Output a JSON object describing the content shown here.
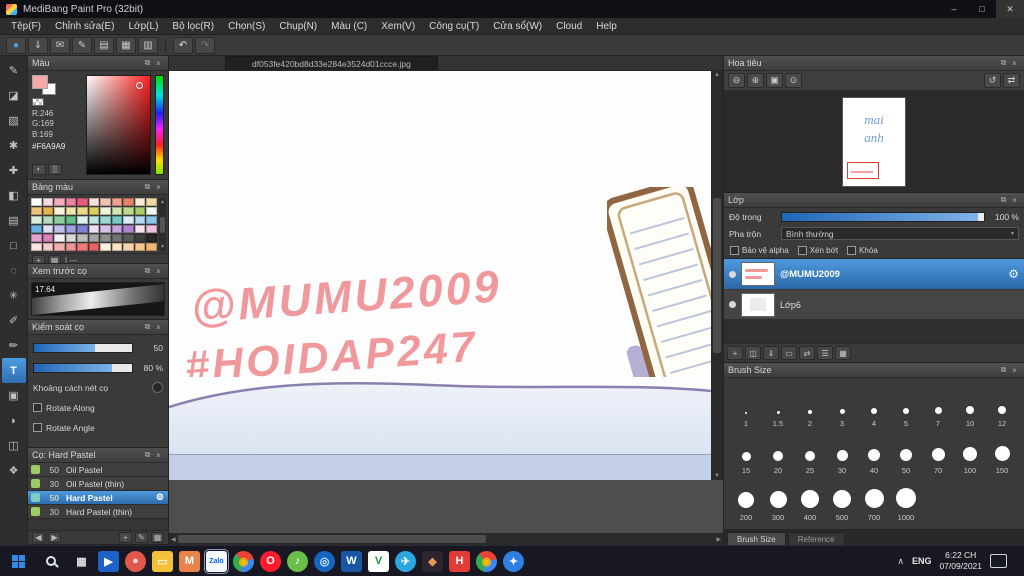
{
  "window": {
    "title": "MediBang Paint Pro (32bit)",
    "min": "–",
    "max": "□",
    "close": "✕"
  },
  "ui": {
    "pop": "⧉",
    "close": "×",
    "arrow_down": "▾",
    "left": "◀",
    "right": "▶",
    "up": "▲",
    "down": "▼",
    "gear": "⚙",
    "chevron_up": "∧"
  },
  "menu": {
    "items": [
      "Tệp(F)",
      "Chỉnh sửa(E)",
      "Lớp(L)",
      "Bộ lọc(R)",
      "Chọn(S)",
      "Chụp(N)",
      "Màu (C)",
      "Xem(V)",
      "Công cụ(T)",
      "Cửa sổ(W)",
      "Cloud",
      "Help"
    ]
  },
  "toolbar": {
    "buttons": [
      {
        "name": "brush-indicator-icon",
        "glyph": "●",
        "fg": "#4aa3e8"
      },
      {
        "name": "save-icon",
        "glyph": "⇓"
      },
      {
        "name": "comment-icon",
        "glyph": "✉"
      },
      {
        "name": "pen-icon",
        "glyph": "✎"
      },
      {
        "name": "page-icon",
        "glyph": "▤"
      },
      {
        "name": "grid-icon",
        "glyph": "▦"
      },
      {
        "name": "material-icon",
        "glyph": "▥"
      }
    ],
    "undo": "↶",
    "redo": "↷"
  },
  "tools": {
    "items": [
      {
        "name": "brush-tool",
        "glyph": "✎"
      },
      {
        "name": "eraser-tool",
        "glyph": "◪"
      },
      {
        "name": "rect-brush-tool",
        "glyph": "▧"
      },
      {
        "name": "smudge-tool",
        "glyph": "✱"
      },
      {
        "name": "move-tool",
        "glyph": "✚"
      },
      {
        "name": "fill-tool",
        "glyph": "◧"
      },
      {
        "name": "gradient-tool",
        "glyph": "▤"
      },
      {
        "name": "select-tool",
        "glyph": "□"
      },
      {
        "name": "lasso-tool",
        "glyph": "◌"
      },
      {
        "name": "magic-wand-tool",
        "glyph": "✳"
      },
      {
        "name": "select-pen-tool",
        "glyph": "✐"
      },
      {
        "name": "select-eraser-tool",
        "glyph": "✏"
      },
      {
        "name": "text-tool",
        "glyph": "T",
        "state": "active"
      },
      {
        "name": "operation-tool",
        "glyph": "▣"
      },
      {
        "name": "eyedropper-tool",
        "glyph": "◗"
      },
      {
        "name": "divide-tool",
        "glyph": "◫"
      },
      {
        "name": "hand-tool",
        "glyph": "❖"
      }
    ]
  },
  "color_panel": {
    "title": "Màu",
    "r": "R:246",
    "g": "G:169",
    "b": "B:169",
    "hex": "#F6A9A9",
    "current": "#F6A9A9",
    "mini": [
      {
        "name": "color-wheel-icon",
        "glyph": "◐"
      },
      {
        "name": "color-bar-icon",
        "glyph": "▒"
      }
    ]
  },
  "palette_panel": {
    "title": "Bảng màu",
    "label": "| ---",
    "foot_icons": [
      {
        "name": "add-swatch-icon",
        "glyph": "+"
      },
      {
        "name": "swatch-grid-icon",
        "glyph": "▦"
      }
    ],
    "swatches": [
      "#ffffff",
      "#f8d7dd",
      "#f2aebd",
      "#ec859c",
      "#e65c7b",
      "#f9e0d9",
      "#f3c1b2",
      "#eca28c",
      "#e58366",
      "#f9ecd2",
      "#f3d9a6",
      "#edc57a",
      "#e7b14e",
      "#f7f3d7",
      "#efe7af",
      "#e7db87",
      "#dfcf5f",
      "#e9f3d9",
      "#d3e7b3",
      "#bddb8d",
      "#a7cf67",
      "#f0f8f1",
      "#d9efdc",
      "#b3dfbf",
      "#8dcfa2",
      "#67bf85",
      "#ddf2f0",
      "#bbe5e1",
      "#99d8d2",
      "#77cbc3",
      "#d9ecf8",
      "#b3d9f1",
      "#8dc6ea",
      "#67b3e3",
      "#dfe0f5",
      "#bfc1eb",
      "#9fa2e1",
      "#7f83d7",
      "#ece0f4",
      "#d9c1e9",
      "#c6a2de",
      "#b383d3",
      "#f6e0ee",
      "#edc1dd",
      "#e4a2cc",
      "#db83bb",
      "#f2f2f2",
      "#d9d9d9",
      "#bfbfbf",
      "#a6a6a6",
      "#8c8c8c",
      "#737373",
      "#595959",
      "#404040",
      "#262626",
      "#fce4e4",
      "#f8caca",
      "#f4b0b0",
      "#f09696",
      "#ec7c7c",
      "#e86262",
      "#fdf1e3",
      "#fae3c7",
      "#f7d5ab",
      "#f4c78f",
      "#f1b973"
    ]
  },
  "preview_panel": {
    "title": "Xem trước cọ",
    "value": "17.64"
  },
  "control_panel": {
    "title": "Kiểm soát cọ",
    "slider1": "50",
    "slider2": "80 %",
    "opt1": "Khoảng cách nét cọ",
    "opt2": "Rotate Along",
    "opt3": "Rotate Angle"
  },
  "brush_panel": {
    "title": "Cọ: Hard Pastel",
    "items": [
      {
        "size": "50",
        "name": "Oil Pastel",
        "chip": "#9ccc65",
        "state": "",
        "gear": ""
      },
      {
        "size": "30",
        "name": "Oil Pastel (thin)",
        "chip": "#9ccc65",
        "state": "",
        "gear": ""
      },
      {
        "size": "50",
        "name": "Hard Pastel",
        "chip": "#80cbc4",
        "state": "selected",
        "gear": "⚙"
      },
      {
        "size": "30",
        "name": "Hard Pastel (thin)",
        "chip": "#9ccc65",
        "state": "",
        "gear": ""
      }
    ],
    "foot_left": [
      {
        "name": "prev-brush-icon",
        "glyph": "◀"
      },
      {
        "name": "next-brush-icon",
        "glyph": "▶"
      }
    ],
    "foot_right": [
      {
        "name": "add-brush-icon",
        "glyph": "+"
      },
      {
        "name": "edit-brush-icon",
        "glyph": "✎"
      },
      {
        "name": "brush-menu-icon",
        "glyph": "▦"
      }
    ]
  },
  "canvas": {
    "tab": "df053fe420bd8d33e284e3524d01ccce.jpg",
    "line1": "@MUMU2009",
    "line2": "#HOIDAP247",
    "ink": "#F0989C"
  },
  "navigator": {
    "title": "Hoa tiêu",
    "zoom_left": [
      {
        "name": "zoom-out-icon",
        "glyph": "⊖"
      },
      {
        "name": "zoom-in-icon",
        "glyph": "⊕"
      },
      {
        "name": "fit-screen-icon",
        "glyph": "▣"
      },
      {
        "name": "actual-size-icon",
        "glyph": "⊙"
      }
    ],
    "zoom_right": [
      {
        "name": "rotate-reset-icon",
        "glyph": "↺"
      },
      {
        "name": "flip-horizontal-icon",
        "glyph": "⇄"
      }
    ],
    "thumb": {
      "word1": "mai",
      "word2": "anh"
    }
  },
  "layers": {
    "title": "Lớp",
    "opacity_label": "Độ trong",
    "opacity_value": "100 %",
    "blend_label": "Pha trộn",
    "blend_value": "Bình thường",
    "checks": [
      "Bảo vệ alpha",
      "Xén bớt",
      "Khóa"
    ],
    "items": [
      {
        "name": "@MUMU2009"
      },
      {
        "name": "Lớp6"
      }
    ],
    "buttons": [
      {
        "name": "add-layer-icon",
        "glyph": "+"
      },
      {
        "name": "duplicate-layer-icon",
        "glyph": "◫"
      },
      {
        "name": "merge-down-icon",
        "glyph": "⇓"
      },
      {
        "name": "folder-icon",
        "glyph": "▭"
      },
      {
        "name": "transfer-layer-icon",
        "glyph": "⇄"
      },
      {
        "name": "layer-menu-icon",
        "glyph": "☰"
      },
      {
        "name": "delete-layer-icon",
        "glyph": "▦"
      }
    ]
  },
  "brush_size": {
    "title": "Brush Size",
    "sizes": [
      "1",
      "1.5",
      "2",
      "3",
      "4",
      "5",
      "7",
      "10",
      "12",
      "15",
      "20",
      "25",
      "30",
      "40",
      "50",
      "70",
      "100",
      "150",
      "200",
      "300",
      "400",
      "500",
      "700",
      "1000"
    ]
  },
  "dock_tabs": {
    "active": "Brush Size",
    "other": "Reference"
  },
  "taskbar": {
    "apps": [
      {
        "name": "task-view-icon",
        "glyph": "▦",
        "bg": "transparent",
        "fg": "#e0e0e0",
        "shape": ""
      },
      {
        "name": "movies-app-icon",
        "glyph": "▶",
        "bg": "#1e62c8",
        "fg": "#ffffff",
        "shape": ""
      },
      {
        "name": "red-circle-app-icon",
        "glyph": "●",
        "bg": "#e2574c",
        "fg": "#ffd4d0",
        "shape": "round"
      },
      {
        "name": "file-explorer-icon",
        "glyph": "▭",
        "bg": "#f3c13a",
        "fg": "#fef3d7",
        "shape": ""
      },
      {
        "name": "medibang-app-icon",
        "glyph": "M",
        "bg": "#e8834a",
        "fg": "#ffffff",
        "shape": ""
      },
      {
        "name": "zalo-app-icon",
        "glyph": "Zalo",
        "bg": "#f4f7fb",
        "fg": "#0c66e4",
        "shape": "zalo active"
      },
      {
        "name": "chrome-icon",
        "glyph": "◉",
        "bg": "conic-gradient(from -45deg, #ea4335 0 120deg, #4285f4 120deg 240deg, #34a853 240deg 360deg)",
        "fg": "#f9bc05",
        "shape": "round"
      },
      {
        "name": "opera-app-icon",
        "glyph": "O",
        "bg": "#ff1b2d",
        "fg": "#ffffff",
        "shape": "round"
      },
      {
        "name": "zing-app-icon",
        "glyph": "♪",
        "bg": "#6abf4b",
        "fg": "#ffffff",
        "shape": "round"
      },
      {
        "name": "blue-circle-app-icon",
        "glyph": "◎",
        "bg": "#1565c0",
        "fg": "#cfe5ff",
        "shape": "round"
      },
      {
        "name": "word-icon",
        "glyph": "W",
        "bg": "#1857a4",
        "fg": "#ffffff",
        "shape": ""
      },
      {
        "name": "v-app-icon",
        "glyph": "V",
        "bg": "#ffffff",
        "fg": "#1f9d44",
        "shape": ""
      },
      {
        "name": "telegram-icon",
        "glyph": "✈",
        "bg": "#2ca5e0",
        "fg": "#ffffff",
        "shape": "round"
      },
      {
        "name": "dark-app-icon",
        "glyph": "◆",
        "bg": "#2d2430",
        "fg": "#e39b54",
        "shape": ""
      },
      {
        "name": "hoidap-app-icon",
        "glyph": "H",
        "bg": "#e23c39",
        "fg": "#ffffff",
        "shape": ""
      },
      {
        "name": "chrome-icon-2",
        "glyph": "◉",
        "bg": "conic-gradient(from -45deg, #ea4335 0 120deg, #4285f4 120deg 240deg, #34a853 240deg 360deg)",
        "fg": "#f9bc05",
        "shape": "round"
      },
      {
        "name": "browser-compass-icon",
        "glyph": "✦",
        "bg": "#2f7fe0",
        "fg": "#ffffff",
        "shape": "round"
      }
    ],
    "tray": {
      "lang": "ENG",
      "time": "6:22 CH",
      "date": "07/09/2021"
    }
  }
}
